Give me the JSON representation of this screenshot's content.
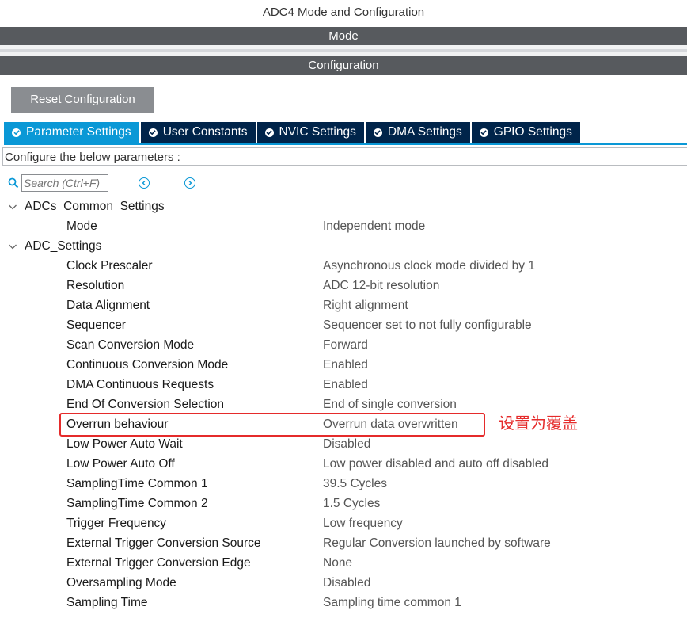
{
  "window": {
    "title": "ADC4 Mode and Configuration"
  },
  "sections": {
    "mode": "Mode",
    "configuration": "Configuration"
  },
  "toolbar": {
    "reset_label": "Reset Configuration"
  },
  "tabs": [
    {
      "label": "Parameter Settings",
      "active": true
    },
    {
      "label": "User Constants",
      "active": false
    },
    {
      "label": "NVIC Settings",
      "active": false
    },
    {
      "label": "DMA Settings",
      "active": false
    },
    {
      "label": "GPIO Settings",
      "active": false
    }
  ],
  "config_hint": "Configure the below parameters :",
  "search": {
    "placeholder": "Search (Ctrl+F)"
  },
  "groups": [
    {
      "label": "ADCs_Common_Settings",
      "params": [
        {
          "name": "Mode",
          "value": "Independent mode"
        }
      ]
    },
    {
      "label": "ADC_Settings",
      "params": [
        {
          "name": "Clock Prescaler",
          "value": "Asynchronous clock mode divided by 1"
        },
        {
          "name": "Resolution",
          "value": "ADC 12-bit resolution"
        },
        {
          "name": "Data Alignment",
          "value": "Right alignment"
        },
        {
          "name": "Sequencer",
          "value": "Sequencer set to not fully configurable"
        },
        {
          "name": "Scan Conversion Mode",
          "value": "Forward"
        },
        {
          "name": "Continuous Conversion Mode",
          "value": "Enabled"
        },
        {
          "name": "DMA Continuous Requests",
          "value": "Enabled"
        },
        {
          "name": "End Of Conversion Selection",
          "value": "End of single conversion"
        },
        {
          "name": "Overrun behaviour",
          "value": "Overrun data overwritten"
        },
        {
          "name": "Low Power Auto Wait",
          "value": "Disabled"
        },
        {
          "name": "Low Power Auto Off",
          "value": "Low power disabled and auto off disabled"
        },
        {
          "name": "SamplingTime Common 1",
          "value": "39.5 Cycles"
        },
        {
          "name": "SamplingTime Common 2",
          "value": "1.5 Cycles"
        },
        {
          "name": "Trigger Frequency",
          "value": "Low frequency"
        },
        {
          "name": "External Trigger Conversion Source",
          "value": "Regular Conversion launched by software"
        },
        {
          "name": "External Trigger Conversion Edge",
          "value": "None"
        },
        {
          "name": "Oversampling Mode",
          "value": "Disabled"
        },
        {
          "name": "Sampling Time",
          "value": "Sampling time common 1"
        }
      ]
    }
  ],
  "annotation": {
    "text": "设置为覆盖",
    "color": "#e52b2b"
  },
  "colors": {
    "accent": "#0a98d6",
    "tab_bg": "#00244a",
    "bar_bg": "#575a5e"
  },
  "icons": {
    "tab": "check-circle-icon",
    "search": "search-icon",
    "prev": "chevron-left-circle-icon",
    "next": "chevron-right-circle-icon",
    "group": "chevron-down-icon"
  }
}
